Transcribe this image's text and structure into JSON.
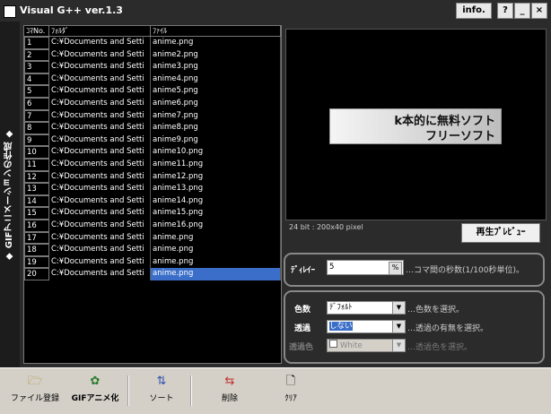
{
  "window": {
    "title": "Visual G++ ver.1.3",
    "info_label": "info.",
    "help_label": "?",
    "minimize_label": "_",
    "close_label": "×"
  },
  "sidebar": {
    "label": "◆ GIFアニメーションの作成 ◆"
  },
  "list": {
    "columns": [
      "ｺﾏNo.",
      "ﾌｫﾙﾀﾞ",
      "ﾌｧｲﾙ"
    ],
    "rows": [
      {
        "no": "1",
        "folder": "C:¥Documents and Setti",
        "file": "anime.png"
      },
      {
        "no": "2",
        "folder": "C:¥Documents and Setti",
        "file": "anime2.png"
      },
      {
        "no": "3",
        "folder": "C:¥Documents and Setti",
        "file": "anime3.png"
      },
      {
        "no": "4",
        "folder": "C:¥Documents and Setti",
        "file": "anime4.png"
      },
      {
        "no": "5",
        "folder": "C:¥Documents and Setti",
        "file": "anime5.png"
      },
      {
        "no": "6",
        "folder": "C:¥Documents and Setti",
        "file": "anime6.png"
      },
      {
        "no": "7",
        "folder": "C:¥Documents and Setti",
        "file": "anime7.png"
      },
      {
        "no": "8",
        "folder": "C:¥Documents and Setti",
        "file": "anime8.png"
      },
      {
        "no": "9",
        "folder": "C:¥Documents and Setti",
        "file": "anime9.png"
      },
      {
        "no": "10",
        "folder": "C:¥Documents and Setti",
        "file": "anime10.png"
      },
      {
        "no": "11",
        "folder": "C:¥Documents and Setti",
        "file": "anime11.png"
      },
      {
        "no": "12",
        "folder": "C:¥Documents and Setti",
        "file": "anime12.png"
      },
      {
        "no": "13",
        "folder": "C:¥Documents and Setti",
        "file": "anime13.png"
      },
      {
        "no": "14",
        "folder": "C:¥Documents and Setti",
        "file": "anime14.png"
      },
      {
        "no": "15",
        "folder": "C:¥Documents and Setti",
        "file": "anime15.png"
      },
      {
        "no": "16",
        "folder": "C:¥Documents and Setti",
        "file": "anime16.png"
      },
      {
        "no": "17",
        "folder": "C:¥Documents and Setti",
        "file": "anime.png"
      },
      {
        "no": "18",
        "folder": "C:¥Documents and Setti",
        "file": "anime.png"
      },
      {
        "no": "19",
        "folder": "C:¥Documents and Setti",
        "file": "anime.png"
      },
      {
        "no": "20",
        "folder": "C:¥Documents and Setti",
        "file": "anime.png"
      }
    ],
    "selected_row": "20"
  },
  "preview": {
    "banner_line1": "k本的に無料ソフト",
    "banner_line2": "フリーソフト",
    "info": "24 bit : 200x40 pixel",
    "play_button": "再生ﾌﾟﾚﾋﾞｭｰ"
  },
  "delay": {
    "label": "ﾃﾞｨﾚｲｰ",
    "value": "5",
    "hint": "…コマ間の秒数(1/100秒単位)。"
  },
  "color_settings": {
    "colors_label": "色数",
    "colors_value": "ﾃﾞﾌｫﾙﾄ",
    "colors_hint": "…色数を選択。",
    "transparency_label": "透過",
    "transparency_value": "しない",
    "transparency_hint": "…透過の有無を選択。",
    "trans_color_label": "透過色",
    "trans_color_value": "White",
    "trans_color_hint": "…透過色を選択。"
  },
  "toolbar": {
    "register_label": "ファイル登録",
    "gif_label": "GIFアニメ化",
    "sort_label": "ソート",
    "delete_label": "削除",
    "clear_label": "ｸﾘｱ"
  },
  "icons": {
    "folder": "folder-open-icon",
    "gif": "gif-animation-icon",
    "sort": "sort-icon",
    "delete": "delete-icon",
    "clear": "clear-icon"
  },
  "colors": {
    "selection": "#3a6ec8",
    "background": "#2b2b2b"
  }
}
